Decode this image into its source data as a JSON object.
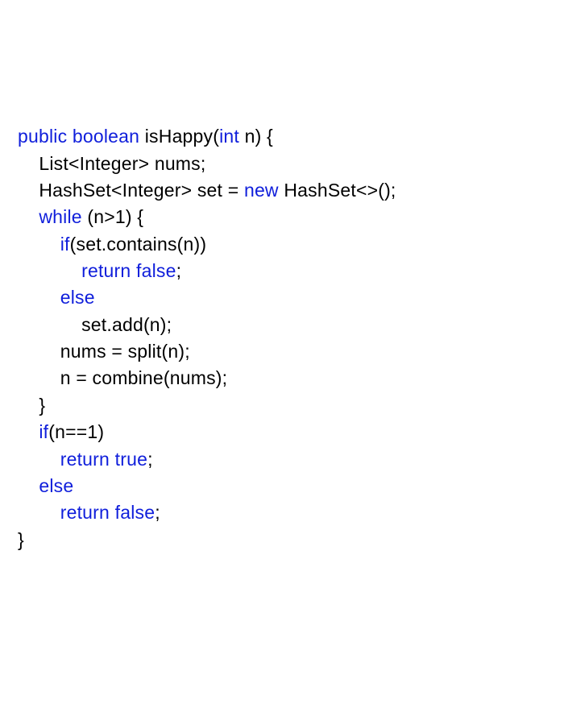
{
  "code": {
    "lines": [
      {
        "indent": 0,
        "segments": [
          {
            "t": "public",
            "c": "kw"
          },
          {
            "t": " "
          },
          {
            "t": "boolean",
            "c": "kw"
          },
          {
            "t": " isHappy("
          },
          {
            "t": "int",
            "c": "kw"
          },
          {
            "t": " n) {"
          }
        ]
      },
      {
        "indent": 0,
        "segments": [
          {
            "t": ""
          }
        ]
      },
      {
        "indent": 1,
        "segments": [
          {
            "t": "List<Integer> nums;"
          }
        ]
      },
      {
        "indent": 1,
        "segments": [
          {
            "t": "HashSet<Integer> set = "
          },
          {
            "t": "new",
            "c": "kw"
          },
          {
            "t": " HashSet<>();"
          }
        ]
      },
      {
        "indent": 1,
        "segments": [
          {
            "t": "while",
            "c": "kw"
          },
          {
            "t": " (n>1) {"
          }
        ]
      },
      {
        "indent": 2,
        "segments": [
          {
            "t": "if",
            "c": "kw"
          },
          {
            "t": "(set.contains(n))"
          }
        ]
      },
      {
        "indent": 3,
        "segments": [
          {
            "t": "return",
            "c": "kw"
          },
          {
            "t": " "
          },
          {
            "t": "false",
            "c": "literal"
          },
          {
            "t": ";"
          }
        ]
      },
      {
        "indent": 2,
        "segments": [
          {
            "t": "else",
            "c": "kw"
          }
        ]
      },
      {
        "indent": 3,
        "segments": [
          {
            "t": "set.add(n);"
          }
        ]
      },
      {
        "indent": 2,
        "segments": [
          {
            "t": "nums = split(n);"
          }
        ]
      },
      {
        "indent": 2,
        "segments": [
          {
            "t": "n = combine(nums);"
          }
        ]
      },
      {
        "indent": 1,
        "segments": [
          {
            "t": "}"
          }
        ]
      },
      {
        "indent": 1,
        "segments": [
          {
            "t": "if",
            "c": "kw"
          },
          {
            "t": "(n==1)"
          }
        ]
      },
      {
        "indent": 2,
        "segments": [
          {
            "t": "return",
            "c": "kw"
          },
          {
            "t": " "
          },
          {
            "t": "true",
            "c": "literal"
          },
          {
            "t": ";"
          }
        ]
      },
      {
        "indent": 1,
        "segments": [
          {
            "t": "else",
            "c": "kw"
          }
        ]
      },
      {
        "indent": 2,
        "segments": [
          {
            "t": "return",
            "c": "kw"
          },
          {
            "t": " "
          },
          {
            "t": "false",
            "c": "literal"
          },
          {
            "t": ";"
          }
        ]
      },
      {
        "indent": 0,
        "segments": [
          {
            "t": "}"
          }
        ]
      }
    ],
    "indentUnit": "    "
  }
}
